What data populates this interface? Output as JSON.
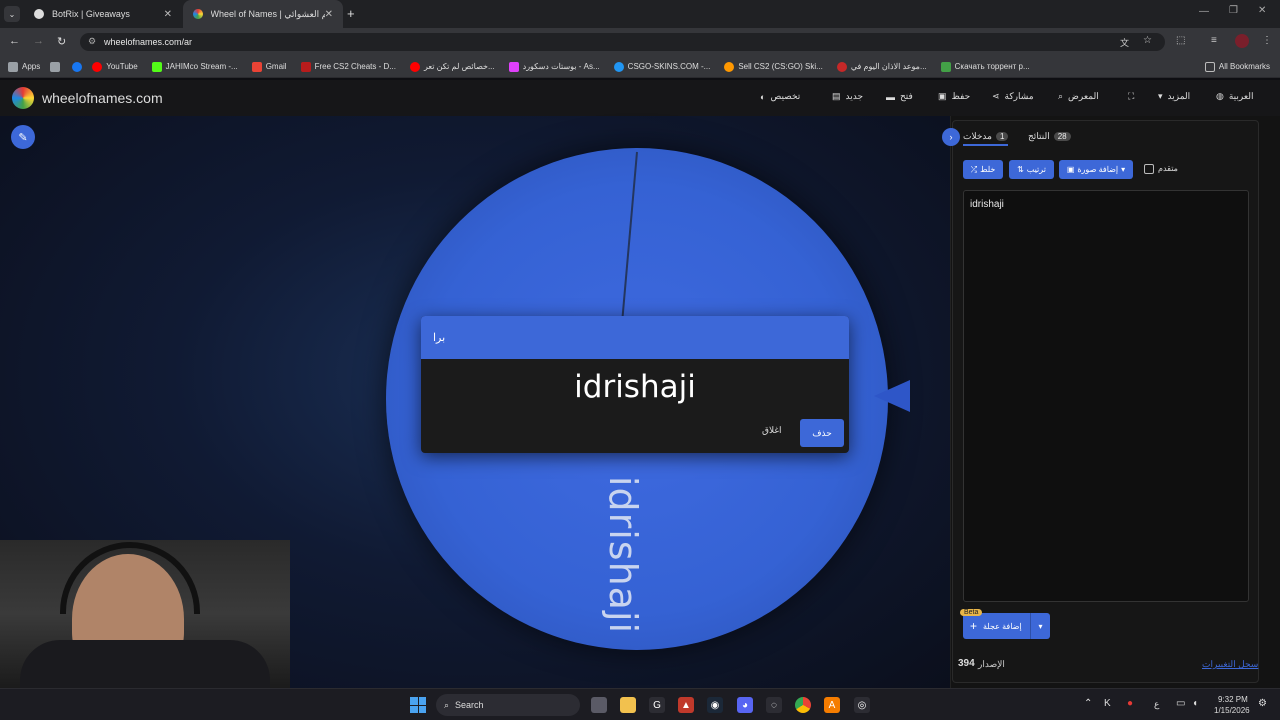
{
  "browser": {
    "tabs": [
      {
        "title": "BotRix | Giveaways",
        "active": false
      },
      {
        "title": "Wheel of Names | اسم العشوائي",
        "active": true
      }
    ],
    "url": "wheelofnames.com/ar",
    "bookmarks": [
      {
        "label": "Apps",
        "icon": "apps-grid-icon",
        "color": "#9aa0a6"
      },
      {
        "label": "",
        "icon": "grid-icon",
        "color": "#9aa0a6"
      },
      {
        "label": "",
        "icon": "facebook-icon",
        "color": "#1877f2"
      },
      {
        "label": "YouTube",
        "icon": "youtube-icon",
        "color": "#ff0000"
      },
      {
        "label": "JAHIMco Stream -...",
        "icon": "kick-icon",
        "color": "#53fc18"
      },
      {
        "label": "Gmail",
        "icon": "gmail-icon",
        "color": "#ea4335"
      },
      {
        "label": "Free CS2 Cheats - D...",
        "icon": "cheat-icon",
        "color": "#b71c1c"
      },
      {
        "label": "خصائص لم تكن تعر...",
        "icon": "youtube-icon",
        "color": "#ff0000"
      },
      {
        "label": "بوستات دسكورد - As...",
        "icon": "gem-icon",
        "color": "#e040fb"
      },
      {
        "label": "CSGO-SKINS.COM -...",
        "icon": "skins-icon",
        "color": "#2196f3"
      },
      {
        "label": "Sell CS2 (CS:GO) Ski...",
        "icon": "sell-icon",
        "color": "#ff9800"
      },
      {
        "label": "موعد الاذان اليوم في...",
        "icon": "prayer-icon",
        "color": "#c62828"
      },
      {
        "label": "Скачать торрент р...",
        "icon": "torrent-icon",
        "color": "#43a047"
      }
    ],
    "all_bookmarks": "All Bookmarks"
  },
  "site": {
    "logo": "wheelofnames.com",
    "nav": [
      {
        "label": "تخصيص",
        "icon": "palette-icon"
      },
      {
        "label": "جديد",
        "icon": "new-file-icon"
      },
      {
        "label": "فتح",
        "icon": "folder-icon"
      },
      {
        "label": "حفظ",
        "icon": "save-icon"
      },
      {
        "label": "مشاركة",
        "icon": "share-icon"
      },
      {
        "label": "المعرض",
        "icon": "search-icon"
      },
      {
        "label": "",
        "icon": "fullscreen-icon"
      },
      {
        "label": "المزيد",
        "icon": "chevron-down-icon"
      },
      {
        "label": "العربية",
        "icon": "globe-icon"
      }
    ]
  },
  "wheel": {
    "segment_label": "idrishaji",
    "color": "#3d68d8"
  },
  "dialog": {
    "title": "برا",
    "winner": "idrishaji",
    "close_label": "اغلاق",
    "remove_label": "حذف"
  },
  "panel": {
    "tabs": [
      {
        "label": "مدخلات",
        "count": "1"
      },
      {
        "label": "النتائج",
        "count": "28"
      }
    ],
    "buttons": {
      "shuffle": "خلط",
      "sort": "ترتيب",
      "add_image": "إضافة صورة",
      "advanced": "متقدم"
    },
    "entries": [
      "idrishaji"
    ],
    "add_wheel": "إضافة عجلة",
    "beta": "Beta",
    "version_label": "الإصدار",
    "version": "394",
    "changelog": "سجل التغييرات"
  },
  "taskbar": {
    "search": "Search",
    "time": "9:32 PM",
    "date": "1/15/2026",
    "lang": "ع"
  }
}
